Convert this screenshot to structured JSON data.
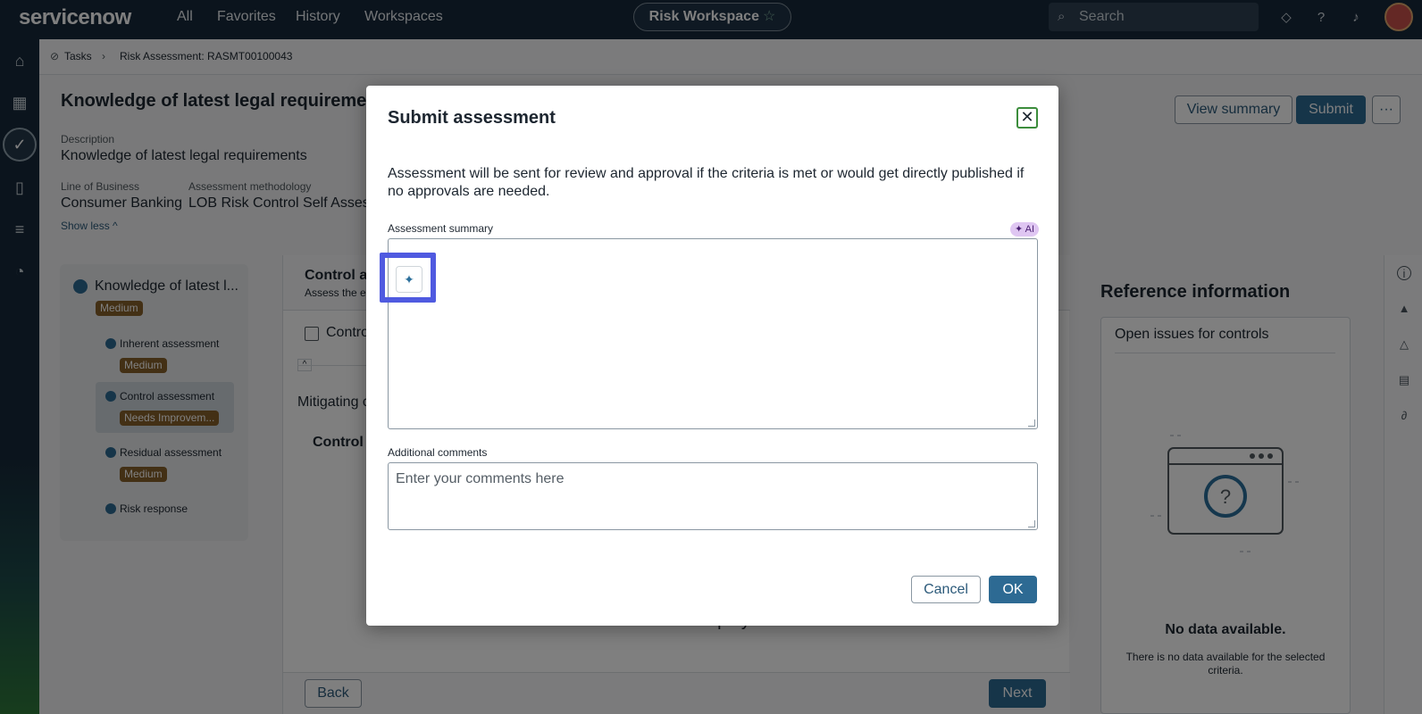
{
  "topbar": {
    "logo": "servicenow",
    "nav": [
      "All",
      "Favorites",
      "History",
      "Workspaces"
    ],
    "workspace": "Risk Workspace",
    "search_placeholder": "Search"
  },
  "breadcrumb": {
    "root": "Tasks",
    "current": "Risk Assessment: RASMT00100043"
  },
  "header": {
    "title": "Knowledge of latest legal requirements",
    "description_label": "Description",
    "description_value": "Knowledge of latest legal requirements",
    "lob_label": "Line of Business",
    "lob_value": "Consumer Banking",
    "method_label": "Assessment methodology",
    "method_value": "LOB Risk Control Self Assessm",
    "show_less": "Show less",
    "view_summary": "View summary",
    "submit": "Submit",
    "more": "···"
  },
  "steps": {
    "title": "Knowledge of latest l...",
    "title_badge": "Medium",
    "items": [
      {
        "label": "Inherent assessment",
        "badge": "Medium"
      },
      {
        "label": "Control assessment",
        "badge": "Needs Improvem..."
      },
      {
        "label": "Residual assessment",
        "badge": "Medium"
      },
      {
        "label": "Risk response",
        "badge": ""
      }
    ]
  },
  "center": {
    "heading": "Control as",
    "subheading": "Assess the eff",
    "checkbox_label": "Contro",
    "mitigating": "Mitigating c",
    "col_control": "Control",
    "no_records": "No records to display.",
    "back": "Back",
    "next": "Next"
  },
  "reference": {
    "title": "Reference information",
    "card_title": "Open issues for controls",
    "no_data": "No data available.",
    "no_data_sub": "There is no data available for the selected criteria."
  },
  "modal": {
    "title": "Submit assessment",
    "description": "Assessment will be sent for review and approval if the criteria is met or would get directly published if no approvals are needed.",
    "summary_label": "Assessment summary",
    "ai_badge": "AI",
    "summary_value": "",
    "comments_label": "Additional comments",
    "comments_placeholder": "Enter your comments here",
    "cancel": "Cancel",
    "ok": "OK"
  },
  "colors": {
    "topbar": "#17293a",
    "primary": "#2d6a93",
    "badge": "#87612a",
    "highlight": "#4f5ae0"
  }
}
